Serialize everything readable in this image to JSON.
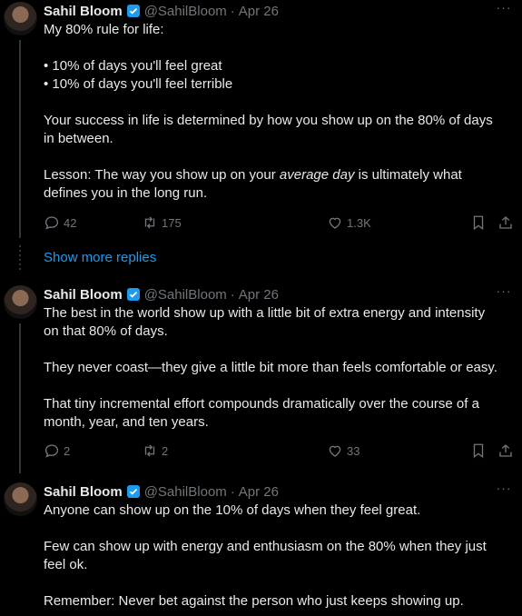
{
  "tweets": [
    {
      "name": "Sahil Bloom",
      "handle": "@SahilBloom",
      "date": "Apr 26",
      "lines": [
        "My 80% rule for life:",
        "",
        "• 10% of days you'll feel great",
        "• 10% of days you'll feel terrible",
        "",
        "Your success in life is determined by how you show up on the 80% of days",
        "in between.",
        "",
        "Lesson: The way you show up on your",
        "defines you in the long run."
      ],
      "italic_phrase": "average day",
      "line9_tail": " is ultimately what",
      "replies": "42",
      "retweets": "175",
      "likes": "1.3K"
    },
    {
      "name": "Sahil Bloom",
      "handle": "@SahilBloom",
      "date": "Apr 26",
      "lines": [
        "The best in the world show up with a little bit of extra energy and intensity",
        "on that 80% of days.",
        "",
        "They never coast—they give a little bit more than feels comfortable or easy.",
        "",
        "That tiny incremental effort compounds dramatically over the course of a",
        "month, year, and ten years."
      ],
      "replies": "2",
      "retweets": "2",
      "likes": "33"
    },
    {
      "name": "Sahil Bloom",
      "handle": "@SahilBloom",
      "date": "Apr 26",
      "lines": [
        "Anyone can show up on the 10% of days when they feel great.",
        "",
        "Few can show up with energy and enthusiasm on the 80% when they just",
        "feel ok.",
        "",
        "Remember: Never bet against the person who just keeps showing up."
      ]
    }
  ],
  "show_more": "Show more replies",
  "colors": {
    "accent": "#1d9bf0",
    "muted": "#71767b",
    "text": "#e7e9ea",
    "bg": "#000000"
  }
}
